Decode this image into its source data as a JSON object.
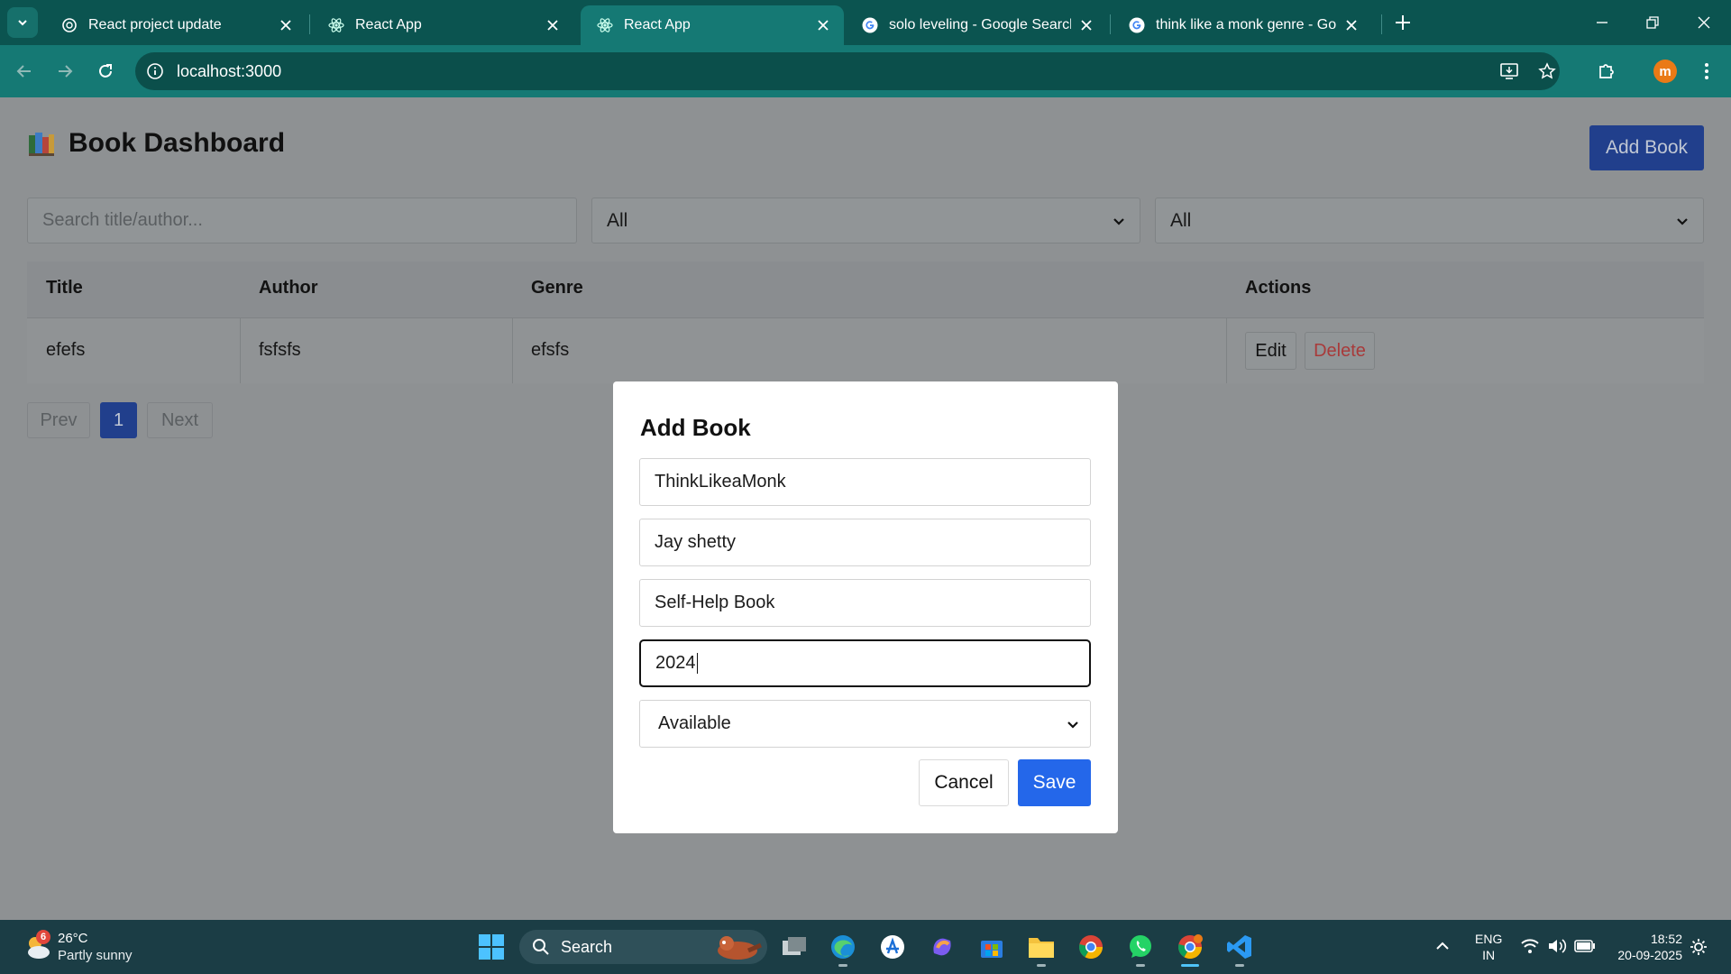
{
  "browser": {
    "tabs": [
      {
        "title": "React project update",
        "favicon": "openai-icon",
        "active": false
      },
      {
        "title": "React App",
        "favicon": "react-icon",
        "active": false
      },
      {
        "title": "React App",
        "favicon": "react-icon",
        "active": true
      },
      {
        "title": "solo leveling - Google Search",
        "favicon": "google-icon",
        "active": false
      },
      {
        "title": "think like a monk genre - Goog",
        "favicon": "google-icon",
        "active": false
      }
    ],
    "url": "localhost:3000",
    "profile_initial": "m",
    "colors": {
      "frame": "#0b5450",
      "toolbar": "#157974",
      "omnibox": "#0b4f4b",
      "profile": "#ea7a16"
    }
  },
  "page": {
    "title": "Book Dashboard",
    "title_icon": "books-icon",
    "add_book_label": "Add Book",
    "search_placeholder": "Search title/author...",
    "filter_genre_value": "All",
    "filter_status_value": "All",
    "table": {
      "headers": [
        "Title",
        "Author",
        "Genre",
        "Actions"
      ],
      "rows": [
        {
          "title": "efefs",
          "author": "fsfsfs",
          "genre": "efsfs",
          "edit_label": "Edit",
          "delete_label": "Delete"
        }
      ]
    },
    "pagination": {
      "prev_label": "Prev",
      "current_page": "1",
      "next_label": "Next"
    },
    "colors": {
      "primary": "#2467ea",
      "danger": "#d32f2f"
    }
  },
  "modal": {
    "title": "Add Book",
    "fields": {
      "title_value": "ThinkLikeaMonk",
      "author_value": "Jay shetty",
      "genre_value": "Self-Help Book",
      "year_value": "2024",
      "status_value": "Available"
    },
    "cancel_label": "Cancel",
    "save_label": "Save"
  },
  "taskbar": {
    "weather": {
      "temp": "26°C",
      "desc": "Partly sunny",
      "badge": "6"
    },
    "search_label": "Search",
    "lang": {
      "line1": "ENG",
      "line2": "IN"
    },
    "clock": {
      "time": "18:52",
      "date": "20-09-2025"
    }
  }
}
